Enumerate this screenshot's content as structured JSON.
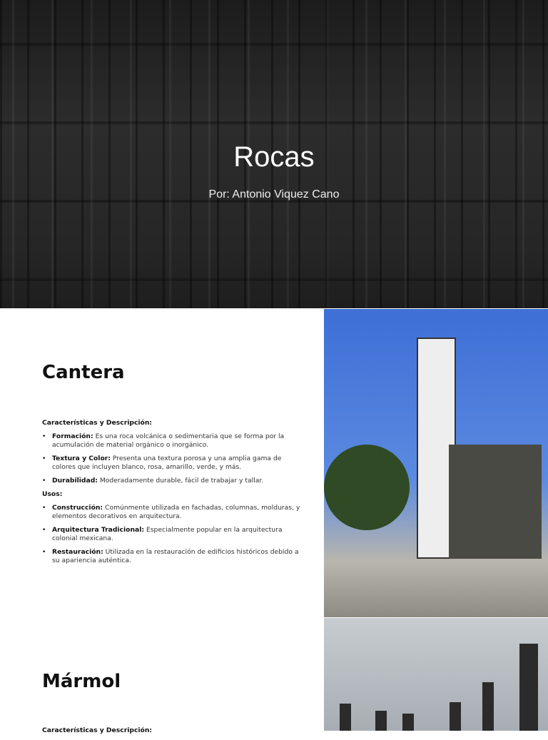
{
  "title_slide": {
    "title": "Rocas",
    "author": "Por:  Antonio Viquez Cano"
  },
  "cantera": {
    "title": "Cantera",
    "desc_heading": "Características y Descripción:",
    "desc": [
      {
        "term": "Formación:",
        "text": " Es una roca volcánica o sedimentaria que se forma por la acumulación de material orgánico o inorgánico."
      },
      {
        "term": "Textura y Color:",
        "text": " Presenta una textura porosa y una amplia gama de colores que incluyen blanco, rosa, amarillo, verde, y más."
      },
      {
        "term": "Durabilidad:",
        "text": " Moderadamente durable, fácil de trabajar y tallar."
      }
    ],
    "uses_heading": "Usos:",
    "uses": [
      {
        "term": "Construcción:",
        "text": " Comúnmente utilizada en fachadas, columnas, molduras, y elementos decorativos en arquitectura."
      },
      {
        "term": "Arquitectura Tradicional:",
        "text": " Especialmente popular en la arquitectura colonial mexicana."
      },
      {
        "term": "Restauración:",
        "text": " Utilizada en la restauración de edificios históricos debido a su apariencia auténtica."
      }
    ]
  },
  "marmol": {
    "title": "Mármol",
    "desc_heading": "Características y Descripción:"
  }
}
